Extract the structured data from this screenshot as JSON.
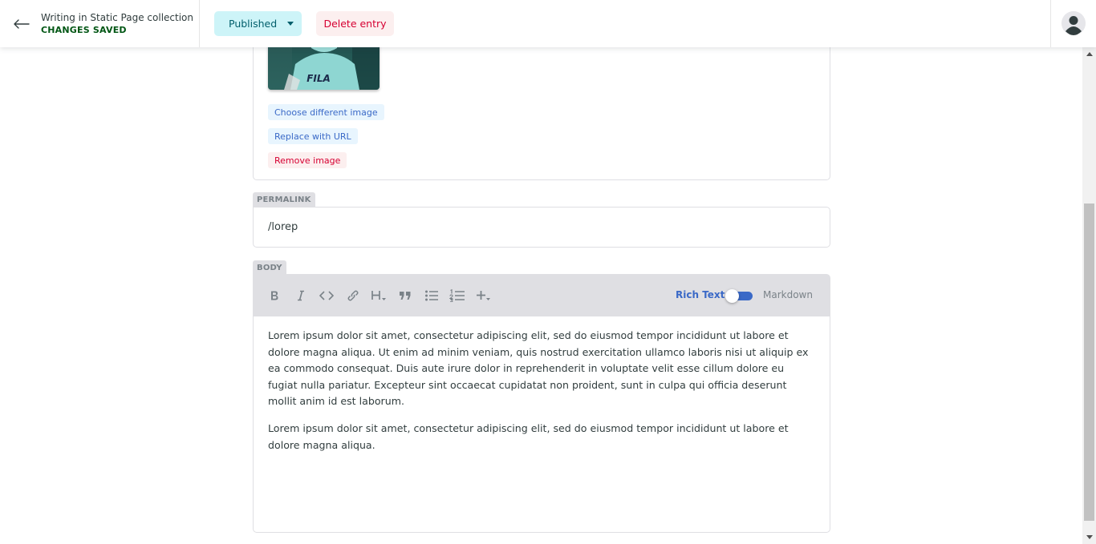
{
  "header": {
    "back_icon": "arrow-left-icon",
    "title": "Writing in Static Page collection",
    "status": "CHANGES SAVED",
    "publish_label": "Published",
    "delete_label": "Delete entry",
    "avatar_icon": "user-avatar-icon"
  },
  "image_widget": {
    "thumbnail_text": "FILA",
    "choose_label": "Choose different image",
    "replace_label": "Replace with URL",
    "remove_label": "Remove image"
  },
  "permalink": {
    "label": "PERMALINK",
    "value": "/lorep"
  },
  "body": {
    "label": "BODY",
    "toolbar": {
      "buttons": [
        "bold-icon",
        "italic-icon",
        "code-icon",
        "link-icon",
        "heading-icon",
        "quote-icon",
        "bulleted-list-icon",
        "numbered-list-icon",
        "add-component-icon"
      ],
      "rich_text_label": "Rich Text",
      "markdown_label": "Markdown",
      "mode": "Rich Text"
    },
    "paragraphs": [
      "Lorem ipsum dolor sit amet, consectetur adipiscing elit, sed do eiusmod tempor incididunt ut labore et dolore magna aliqua. Ut enim ad minim veniam, quis nostrud exercitation ullamco laboris nisi ut aliquip ex ea commodo consequat. Duis aute irure dolor in reprehenderit in voluptate velit esse cillum dolore eu fugiat nulla pariatur. Excepteur sint occaecat cupidatat non proident, sunt in culpa qui officia deserunt mollit anim id est laborum.",
      "Lorem ipsum dolor sit amet, consectetur adipiscing elit, sed do eiusmod tempor incididunt ut labore et dolore magna aliqua."
    ]
  },
  "colors": {
    "published_bg": "#cdf4f8",
    "published_text": "#005e6b",
    "delete_bg": "#fcefef",
    "delete_text": "#d60032",
    "status_green": "#005614",
    "accent_blue": "#3a69c7"
  }
}
